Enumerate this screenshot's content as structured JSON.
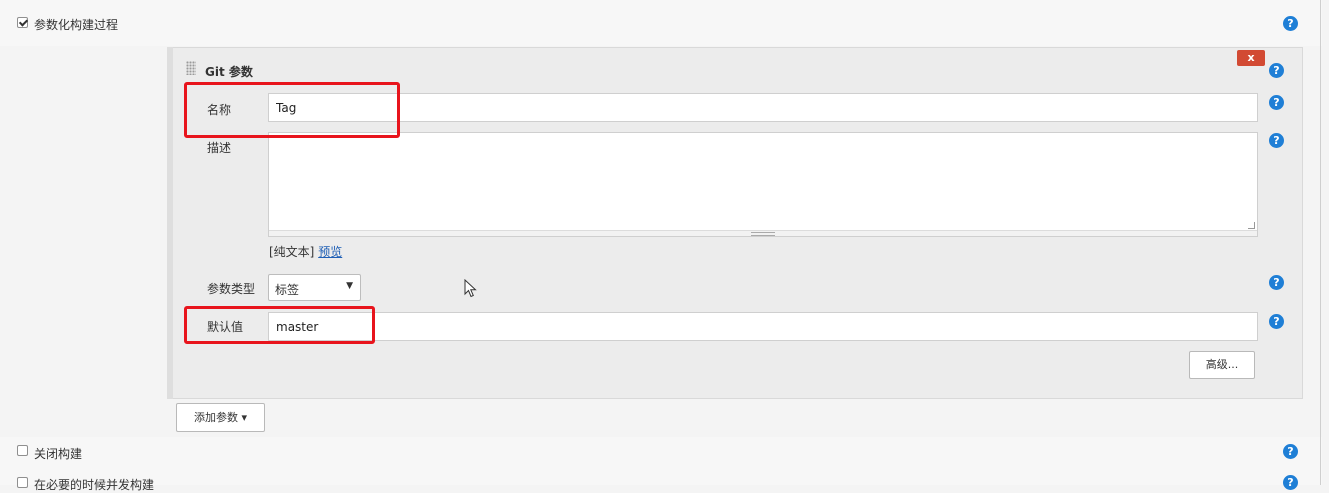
{
  "section": {
    "parameterized_label": "参数化构建过程",
    "parameterized_checked": true
  },
  "git_param": {
    "title": "Git 参数",
    "delete_label": "x",
    "name_label": "名称",
    "name_value": "Tag",
    "desc_label": "描述",
    "desc_value": "",
    "plain_text": "[纯文本]",
    "preview": "预览",
    "type_label": "参数类型",
    "type_value": "标签",
    "default_label": "默认值",
    "default_value": "master",
    "advanced": "高级..."
  },
  "add_param": {
    "label": "添加参数",
    "arrow": "▾"
  },
  "options": [
    {
      "label": "关闭构建",
      "checked": false
    },
    {
      "label": "在必要的时候并发构建",
      "checked": false
    }
  ],
  "help_glyph": "?",
  "colors": {
    "help_blue": "#1f7fd6",
    "delete_red": "#d24a33",
    "highlight_red": "#e8141c",
    "link_blue": "#1f5fb5"
  }
}
